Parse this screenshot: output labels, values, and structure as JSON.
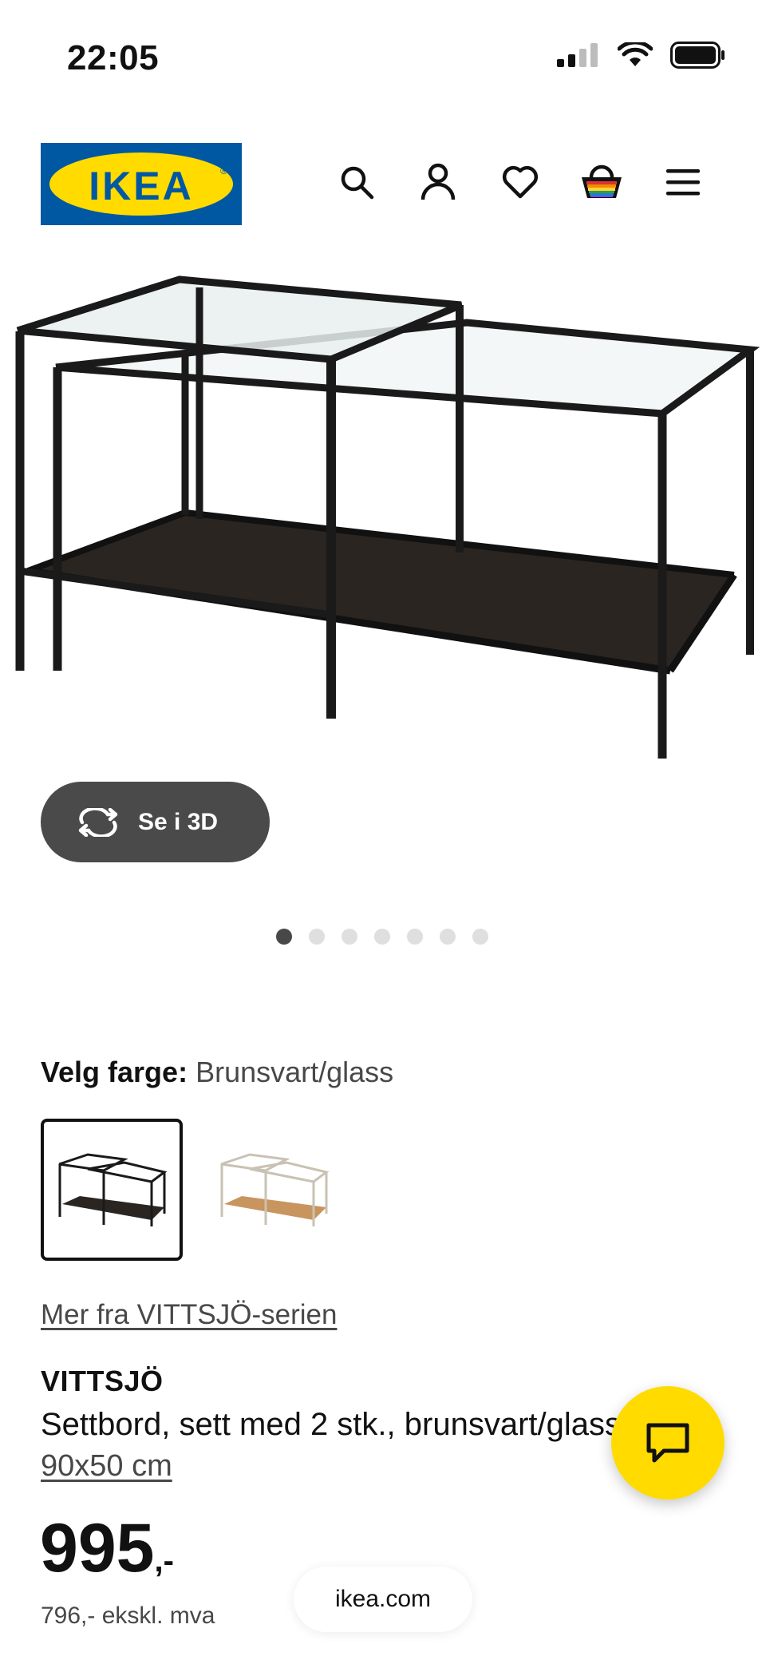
{
  "status_bar": {
    "time": "22:05",
    "icons": [
      "signal-icon",
      "wifi-icon",
      "battery-icon"
    ]
  },
  "header": {
    "logo_text": "IKEA",
    "icons": [
      "search-icon",
      "account-icon",
      "heart-icon",
      "basket-icon",
      "menu-icon"
    ]
  },
  "gallery": {
    "view_3d_label": "Se i 3D",
    "image_count": 7,
    "active_index": 0
  },
  "color_picker": {
    "label": "Velg farge:",
    "selected_value": "Brunsvart/glass",
    "options": [
      "Brunsvart/glass",
      "Hvit/glass"
    ]
  },
  "series_link": "Mer fra VITTSJÖ-serien",
  "product": {
    "name": "VITTSJÖ",
    "description": "Settbord, sett med 2 stk., brunsvart/glass",
    "size": "90x50 cm",
    "price": "995",
    "price_suffix": ",-",
    "price_excl_vat": "796,- ekskl. mva"
  },
  "browser": {
    "url": "ikea.com"
  },
  "colors": {
    "brand_blue": "#0058A3",
    "brand_yellow": "#FFDB00",
    "button_dark": "#4a4a4a"
  }
}
